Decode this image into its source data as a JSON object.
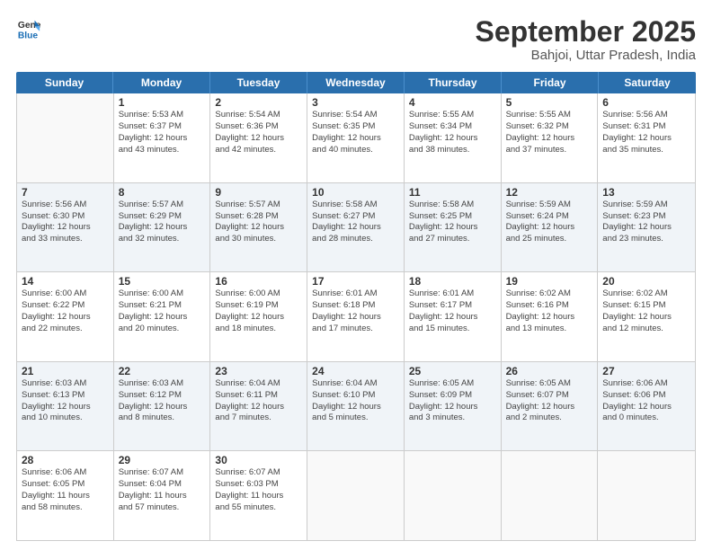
{
  "header": {
    "logo_line1": "General",
    "logo_line2": "Blue",
    "month": "September 2025",
    "location": "Bahjoi, Uttar Pradesh, India"
  },
  "days_of_week": [
    "Sunday",
    "Monday",
    "Tuesday",
    "Wednesday",
    "Thursday",
    "Friday",
    "Saturday"
  ],
  "weeks": [
    [
      {
        "num": "",
        "info": ""
      },
      {
        "num": "1",
        "info": "Sunrise: 5:53 AM\nSunset: 6:37 PM\nDaylight: 12 hours\nand 43 minutes."
      },
      {
        "num": "2",
        "info": "Sunrise: 5:54 AM\nSunset: 6:36 PM\nDaylight: 12 hours\nand 42 minutes."
      },
      {
        "num": "3",
        "info": "Sunrise: 5:54 AM\nSunset: 6:35 PM\nDaylight: 12 hours\nand 40 minutes."
      },
      {
        "num": "4",
        "info": "Sunrise: 5:55 AM\nSunset: 6:34 PM\nDaylight: 12 hours\nand 38 minutes."
      },
      {
        "num": "5",
        "info": "Sunrise: 5:55 AM\nSunset: 6:32 PM\nDaylight: 12 hours\nand 37 minutes."
      },
      {
        "num": "6",
        "info": "Sunrise: 5:56 AM\nSunset: 6:31 PM\nDaylight: 12 hours\nand 35 minutes."
      }
    ],
    [
      {
        "num": "7",
        "info": "Sunrise: 5:56 AM\nSunset: 6:30 PM\nDaylight: 12 hours\nand 33 minutes."
      },
      {
        "num": "8",
        "info": "Sunrise: 5:57 AM\nSunset: 6:29 PM\nDaylight: 12 hours\nand 32 minutes."
      },
      {
        "num": "9",
        "info": "Sunrise: 5:57 AM\nSunset: 6:28 PM\nDaylight: 12 hours\nand 30 minutes."
      },
      {
        "num": "10",
        "info": "Sunrise: 5:58 AM\nSunset: 6:27 PM\nDaylight: 12 hours\nand 28 minutes."
      },
      {
        "num": "11",
        "info": "Sunrise: 5:58 AM\nSunset: 6:25 PM\nDaylight: 12 hours\nand 27 minutes."
      },
      {
        "num": "12",
        "info": "Sunrise: 5:59 AM\nSunset: 6:24 PM\nDaylight: 12 hours\nand 25 minutes."
      },
      {
        "num": "13",
        "info": "Sunrise: 5:59 AM\nSunset: 6:23 PM\nDaylight: 12 hours\nand 23 minutes."
      }
    ],
    [
      {
        "num": "14",
        "info": "Sunrise: 6:00 AM\nSunset: 6:22 PM\nDaylight: 12 hours\nand 22 minutes."
      },
      {
        "num": "15",
        "info": "Sunrise: 6:00 AM\nSunset: 6:21 PM\nDaylight: 12 hours\nand 20 minutes."
      },
      {
        "num": "16",
        "info": "Sunrise: 6:00 AM\nSunset: 6:19 PM\nDaylight: 12 hours\nand 18 minutes."
      },
      {
        "num": "17",
        "info": "Sunrise: 6:01 AM\nSunset: 6:18 PM\nDaylight: 12 hours\nand 17 minutes."
      },
      {
        "num": "18",
        "info": "Sunrise: 6:01 AM\nSunset: 6:17 PM\nDaylight: 12 hours\nand 15 minutes."
      },
      {
        "num": "19",
        "info": "Sunrise: 6:02 AM\nSunset: 6:16 PM\nDaylight: 12 hours\nand 13 minutes."
      },
      {
        "num": "20",
        "info": "Sunrise: 6:02 AM\nSunset: 6:15 PM\nDaylight: 12 hours\nand 12 minutes."
      }
    ],
    [
      {
        "num": "21",
        "info": "Sunrise: 6:03 AM\nSunset: 6:13 PM\nDaylight: 12 hours\nand 10 minutes."
      },
      {
        "num": "22",
        "info": "Sunrise: 6:03 AM\nSunset: 6:12 PM\nDaylight: 12 hours\nand 8 minutes."
      },
      {
        "num": "23",
        "info": "Sunrise: 6:04 AM\nSunset: 6:11 PM\nDaylight: 12 hours\nand 7 minutes."
      },
      {
        "num": "24",
        "info": "Sunrise: 6:04 AM\nSunset: 6:10 PM\nDaylight: 12 hours\nand 5 minutes."
      },
      {
        "num": "25",
        "info": "Sunrise: 6:05 AM\nSunset: 6:09 PM\nDaylight: 12 hours\nand 3 minutes."
      },
      {
        "num": "26",
        "info": "Sunrise: 6:05 AM\nSunset: 6:07 PM\nDaylight: 12 hours\nand 2 minutes."
      },
      {
        "num": "27",
        "info": "Sunrise: 6:06 AM\nSunset: 6:06 PM\nDaylight: 12 hours\nand 0 minutes."
      }
    ],
    [
      {
        "num": "28",
        "info": "Sunrise: 6:06 AM\nSunset: 6:05 PM\nDaylight: 11 hours\nand 58 minutes."
      },
      {
        "num": "29",
        "info": "Sunrise: 6:07 AM\nSunset: 6:04 PM\nDaylight: 11 hours\nand 57 minutes."
      },
      {
        "num": "30",
        "info": "Sunrise: 6:07 AM\nSunset: 6:03 PM\nDaylight: 11 hours\nand 55 minutes."
      },
      {
        "num": "",
        "info": ""
      },
      {
        "num": "",
        "info": ""
      },
      {
        "num": "",
        "info": ""
      },
      {
        "num": "",
        "info": ""
      }
    ]
  ]
}
